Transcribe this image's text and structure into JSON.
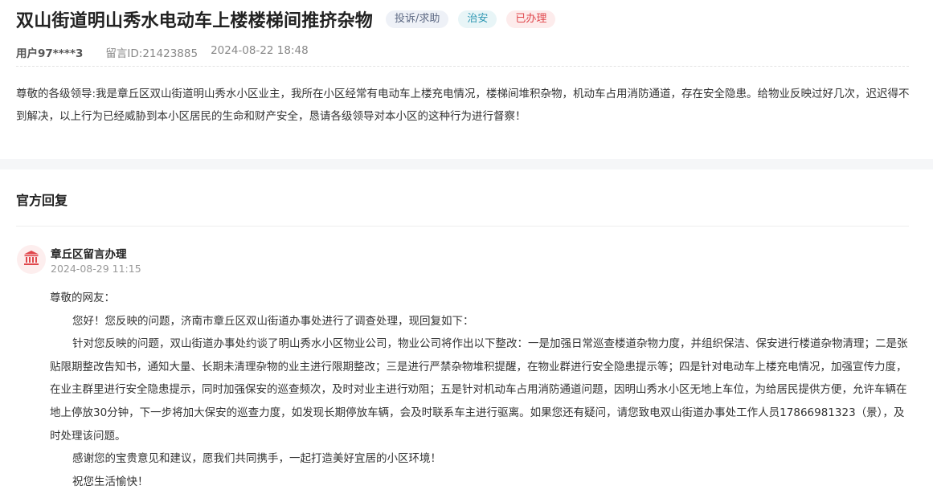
{
  "post": {
    "title": "双山街道明山秀水电动车上楼楼梯间推挤杂物",
    "tags": {
      "category": "投诉/求助",
      "topic": "治安",
      "status": "已办理"
    },
    "user": "用户97****3",
    "message_id": "留言ID:21423885",
    "datetime": "2024-08-22 18:48",
    "content": "尊敬的各级领导:我是章丘区双山街道明山秀水小区业主，我所在小区经常有电动车上楼充电情况，楼梯间堆积杂物，机动车占用消防通道，存在安全隐患。给物业反映过好几次，迟迟得不到解决，以上行为已经威胁到本小区居民的生命和财产安全，恳请各级领导对本小区的这种行为进行督察！"
  },
  "reply": {
    "heading": "官方回复",
    "org_name": "章丘区留言办理",
    "datetime": "2024-08-29 11:15",
    "greeting": "尊敬的网友：",
    "para1": "您好！您反映的问题，济南市章丘区双山街道办事处进行了调查处理，现回复如下：",
    "para2": "针对您反映的问题，双山街道办事处约谈了明山秀水小区物业公司，物业公司将作出以下整改：一是加强日常巡查楼道杂物力度，并组织保洁、保安进行楼道杂物清理；二是张贴限期整改告知书，通知大量、长期未清理杂物的业主进行限期整改；三是进行严禁杂物堆积提醒，在物业群进行安全隐患提示等；四是针对电动车上楼充电情况，加强宣传力度，在业主群里进行安全隐患提示，同时加强保安的巡查频次，及时对业主进行劝阻；五是针对机动车占用消防通道问题，因明山秀水小区无地上车位，为给居民提供方便，允许车辆在地上停放30分钟，下一步将加大保安的巡查力度，如发现长期停放车辆，会及时联系车主进行驱离。如果您还有疑问，请您致电双山街道办事处工作人员17866981323（景），及时处理该问题。",
    "para3": "感谢您的宝贵意见和建议，愿我们共同携手，一起打造美好宜居的小区环境！",
    "closing": "祝您生活愉快！"
  },
  "colors": {
    "tag_complaint_text": "#5f6b85",
    "tag_security_text": "#2f98b3",
    "tag_done_text": "#e0474c",
    "avatar_icon": "#e0474c"
  },
  "icons": {
    "org_avatar": "government-building-icon"
  }
}
